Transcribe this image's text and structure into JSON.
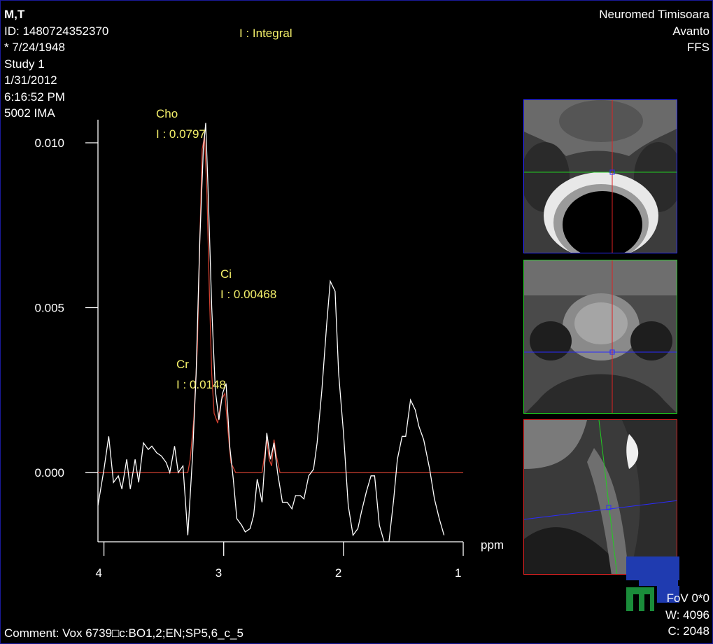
{
  "patient": {
    "name": "M,T",
    "id": "ID: 1480724352370",
    "birth": "* 7/24/1948",
    "study": "Study 1",
    "date": "1/31/2012",
    "time": "6:16:52 PM",
    "image": "5002 IMA"
  },
  "site": {
    "institution": "Neuromed Timisoara",
    "scanner": "Avanto",
    "position": "FFS"
  },
  "legend": "I : Integral",
  "window": {
    "fov": "FoV 0*0",
    "width": "W: 4096",
    "center": "C: 2048"
  },
  "comment": "Comment: Vox 6739□c:BO1,2;EN;SP5,6_c_5",
  "colors": {
    "annotation": "#f4f06a",
    "spectrum": "#ffffff",
    "fit": "#d04030",
    "axial_frame": "#2b2bff",
    "coronal_frame": "#22cc22",
    "sagittal_frame": "#dd2222"
  },
  "chart_data": {
    "type": "line",
    "xlabel": "ppm",
    "ylabel": "",
    "x_reversed": true,
    "xlim": [
      4.05,
      1.0
    ],
    "ylim": [
      -0.0021,
      0.0107
    ],
    "x_ticks": [
      {
        "value": 4,
        "label": "4"
      },
      {
        "value": 3,
        "label": "3"
      },
      {
        "value": 2,
        "label": "2"
      },
      {
        "value": 1,
        "label": "1"
      }
    ],
    "y_ticks": [
      {
        "value": 0.01,
        "label": "0.010"
      },
      {
        "value": 0.005,
        "label": "0.005"
      },
      {
        "value": 0.0,
        "label": "0.000"
      }
    ],
    "series": [
      {
        "role": "spectrum",
        "points": [
          [
            4.05,
            -0.001
          ],
          [
            4.0,
            0.0001
          ],
          [
            3.96,
            0.0011
          ],
          [
            3.92,
            -0.0003
          ],
          [
            3.88,
            -0.0001
          ],
          [
            3.85,
            -0.0005
          ],
          [
            3.81,
            0.0004
          ],
          [
            3.78,
            -0.0005
          ],
          [
            3.74,
            0.0004
          ],
          [
            3.71,
            -0.0003
          ],
          [
            3.67,
            0.0009
          ],
          [
            3.63,
            0.0007
          ],
          [
            3.6,
            0.0008
          ],
          [
            3.56,
            0.0006
          ],
          [
            3.52,
            0.0005
          ],
          [
            3.48,
            0.0003
          ],
          [
            3.45,
            0.0
          ],
          [
            3.41,
            0.0008
          ],
          [
            3.38,
            0.0
          ],
          [
            3.34,
            0.0002
          ],
          [
            3.3,
            -0.0019
          ],
          [
            3.26,
            0.0005
          ],
          [
            3.23,
            0.003
          ],
          [
            3.2,
            0.007
          ],
          [
            3.17,
            0.0098
          ],
          [
            3.15,
            0.0106
          ],
          [
            3.13,
            0.0085
          ],
          [
            3.1,
            0.005
          ],
          [
            3.07,
            0.0025
          ],
          [
            3.04,
            0.0016
          ],
          [
            3.01,
            0.0024
          ],
          [
            2.98,
            0.0027
          ],
          [
            2.95,
            0.0008
          ],
          [
            2.92,
            -0.0002
          ],
          [
            2.89,
            -0.0014
          ],
          [
            2.85,
            -0.0016
          ],
          [
            2.82,
            -0.0018
          ],
          [
            2.78,
            -0.0017
          ],
          [
            2.75,
            -0.0013
          ],
          [
            2.72,
            -0.0002
          ],
          [
            2.68,
            -0.0009
          ],
          [
            2.64,
            0.0012
          ],
          [
            2.61,
            0.0004
          ],
          [
            2.58,
            0.0009
          ],
          [
            2.55,
            0.0
          ],
          [
            2.51,
            -0.0009
          ],
          [
            2.47,
            -0.0009
          ],
          [
            2.43,
            -0.0011
          ],
          [
            2.4,
            -0.0007
          ],
          [
            2.36,
            -0.0007
          ],
          [
            2.33,
            -0.0008
          ],
          [
            2.29,
            -0.0001
          ],
          [
            2.25,
            0.0001
          ],
          [
            2.22,
            0.0009
          ],
          [
            2.18,
            0.0025
          ],
          [
            2.14,
            0.0045
          ],
          [
            2.11,
            0.0058
          ],
          [
            2.07,
            0.0055
          ],
          [
            2.04,
            0.003
          ],
          [
            2.0,
            0.0012
          ],
          [
            1.96,
            -0.001
          ],
          [
            1.92,
            -0.0019
          ],
          [
            1.88,
            -0.0017
          ],
          [
            1.85,
            -0.0012
          ],
          [
            1.81,
            -0.0006
          ],
          [
            1.77,
            -0.0001
          ],
          [
            1.74,
            -0.0001
          ],
          [
            1.7,
            -0.0016
          ],
          [
            1.66,
            -0.0021
          ],
          [
            1.62,
            -0.0021
          ],
          [
            1.58,
            -0.0008
          ],
          [
            1.55,
            0.0004
          ],
          [
            1.51,
            0.0011
          ],
          [
            1.48,
            0.0011
          ],
          [
            1.44,
            0.0022
          ],
          [
            1.4,
            0.0019
          ],
          [
            1.37,
            0.0014
          ],
          [
            1.33,
            0.001
          ],
          [
            1.28,
            0.0001
          ],
          [
            1.24,
            -0.0008
          ],
          [
            1.2,
            -0.0014
          ],
          [
            1.16,
            -0.0019
          ]
        ]
      },
      {
        "role": "fit",
        "points": [
          [
            4.05,
            0.0
          ],
          [
            3.4,
            0.0
          ],
          [
            3.3,
            0.0
          ],
          [
            3.28,
            0.0004
          ],
          [
            3.25,
            0.0016
          ],
          [
            3.22,
            0.0038
          ],
          [
            3.2,
            0.007
          ],
          [
            3.18,
            0.0098
          ],
          [
            3.16,
            0.0102
          ],
          [
            3.14,
            0.0085
          ],
          [
            3.12,
            0.0055
          ],
          [
            3.1,
            0.003
          ],
          [
            3.08,
            0.0018
          ],
          [
            3.05,
            0.0015
          ],
          [
            3.02,
            0.0022
          ],
          [
            2.99,
            0.0024
          ],
          [
            2.97,
            0.0015
          ],
          [
            2.94,
            0.0003
          ],
          [
            2.9,
            0.0
          ],
          [
            2.68,
            0.0
          ],
          [
            2.66,
            0.0005
          ],
          [
            2.64,
            0.001
          ],
          [
            2.62,
            0.0004
          ],
          [
            2.6,
            0.0002
          ],
          [
            2.58,
            0.001
          ],
          [
            2.56,
            0.0005
          ],
          [
            2.53,
            0.0
          ],
          [
            1.0,
            0.0
          ]
        ]
      }
    ],
    "annotations": [
      {
        "name": "Cho",
        "integral": "I : 0.0797"
      },
      {
        "name": "Ci",
        "integral": "I : 0.00468"
      },
      {
        "name": "Cr",
        "integral": "I : 0.0148"
      }
    ]
  }
}
